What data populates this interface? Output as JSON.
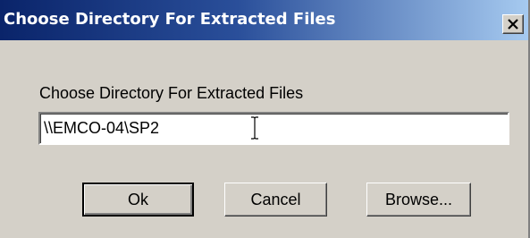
{
  "window": {
    "title": "Choose Directory For Extracted Files",
    "close_icon": "close-icon"
  },
  "form": {
    "prompt": "Choose Directory For Extracted Files",
    "directory_value": "\\\\EMCO-04\\SP2"
  },
  "buttons": {
    "ok": "Ok",
    "cancel": "Cancel",
    "browse": "Browse..."
  },
  "colors": {
    "titlebar_start": "#0a246a",
    "titlebar_end": "#a6caf0",
    "face": "#d4d0c8"
  }
}
